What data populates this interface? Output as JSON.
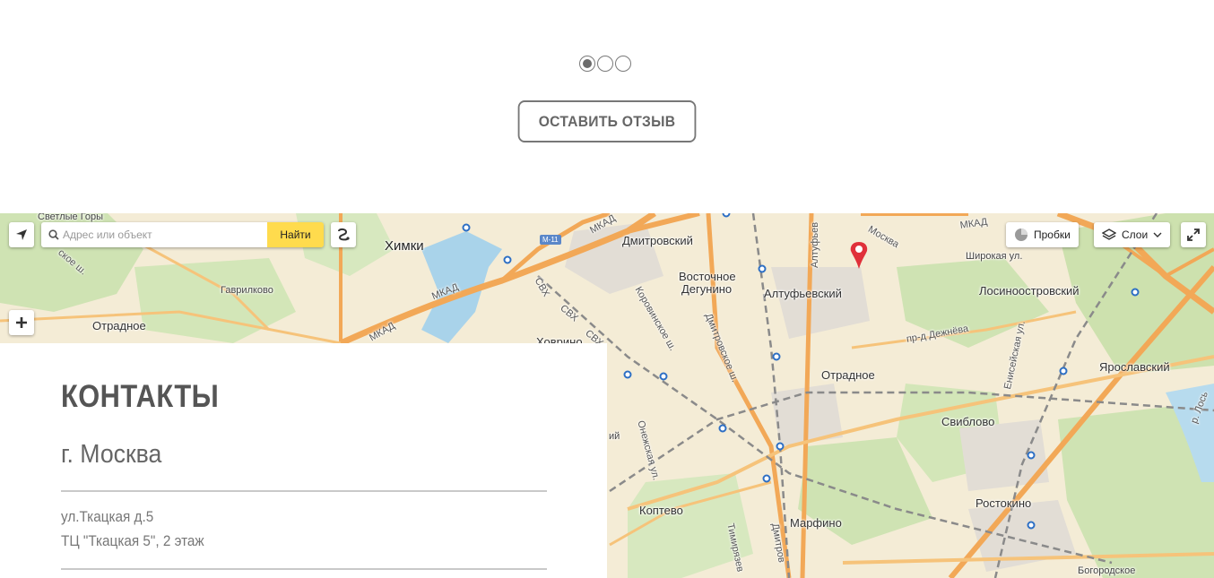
{
  "slider": {
    "dots": 3,
    "active_index": 0
  },
  "review_button": {
    "label": "ОСТАВИТЬ ОТЗЫВ"
  },
  "map": {
    "search": {
      "placeholder": "Адрес или объект",
      "button_label": "Найти"
    },
    "traffic_label": "Пробки",
    "layers_label": "Слои",
    "highway_badge": "M-11",
    "places": {
      "svetlye_gory": "Светлые Горы",
      "khimki": "Химки",
      "gavrilkovo": "Гаврилково",
      "otradnoe_west": "Отрадное",
      "khovrino": "Ховрино",
      "dmitrovsky": "Дмитровский",
      "vostochnoe_degunino_1": "Восточное",
      "vostochnoe_degunino_2": "Дегунино",
      "altufyevsky": "Алтуфьевский",
      "shirokaya": "Широкая ул.",
      "losinoostrovsky": "Лосиноостровский",
      "otradnoe": "Отрадное",
      "yaroslavsky": "Ярославский",
      "sviblovo": "Свиблово",
      "koptevo": "Коптево",
      "marfino": "Марфино",
      "rostokino": "Ростокино",
      "bogorodskoe": "Богородское",
      "ii": "ий"
    },
    "roads": {
      "mkad_1": "МКАД",
      "mkad_2": "МКАД",
      "mkad_3": "МКАД",
      "mkad_4": "МКАД",
      "svkh_1": "СВХ",
      "svkh_2": "СВХ",
      "svkh_3": "СВХ",
      "koroviskoe": "Коровинское ш.",
      "dmitrovskoe": "Дмитровское ш.",
      "dmitrovskoe_2": "Дмитров",
      "altufyevskoe": "Алтуфьев",
      "dezhneva": "пр-д Дежнёва",
      "eniseyskaya": "Енисейская ул.",
      "oneжskaya": "Онежская ул.",
      "timiryazev": "Тимирязев",
      "leningradskoe": "ское ш.",
      "losya": "р. Лось",
      "moskva_road": "Москва"
    }
  },
  "contacts": {
    "title": "КОНТАКТЫ",
    "city": "г. Москва",
    "address_line1": "ул.Ткацкая д.5",
    "address_line2": "ТЦ \"Ткацкая 5\", 2 этаж"
  }
}
